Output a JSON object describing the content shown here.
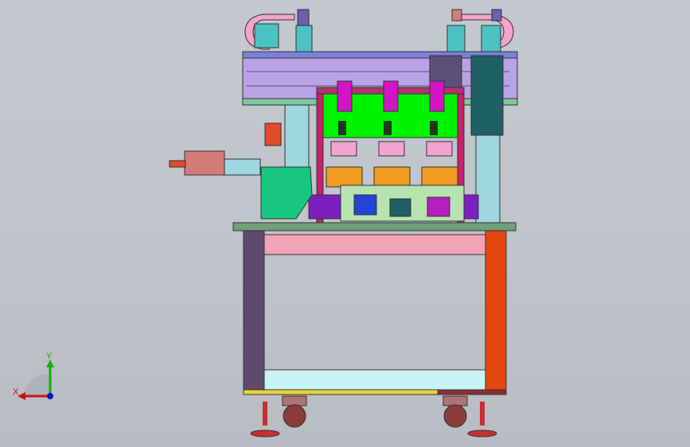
{
  "viewport": {
    "background": "#c1c5cc",
    "view": "front"
  },
  "triad": {
    "x_label": "X",
    "y_label": "Y",
    "x_color": "#d01010",
    "y_color": "#10b010",
    "z_color": "#1010d0"
  },
  "colors": {
    "frame_purple": "#5e4a6e",
    "frame_orange": "#e5480e",
    "pink_rail": "#f2a3b9",
    "cyan_rail": "#c8f4f4",
    "lavender_beam": "#b9a2e6",
    "green_plate": "#00f400",
    "teal_guard": "#17c77f",
    "magenta_cylinder": "#d215c4",
    "blue_block": "#2543d6",
    "dark_teal_column": "#1f5f66",
    "orange_jig": "#f09b22",
    "table_top": "#6fa07a"
  }
}
